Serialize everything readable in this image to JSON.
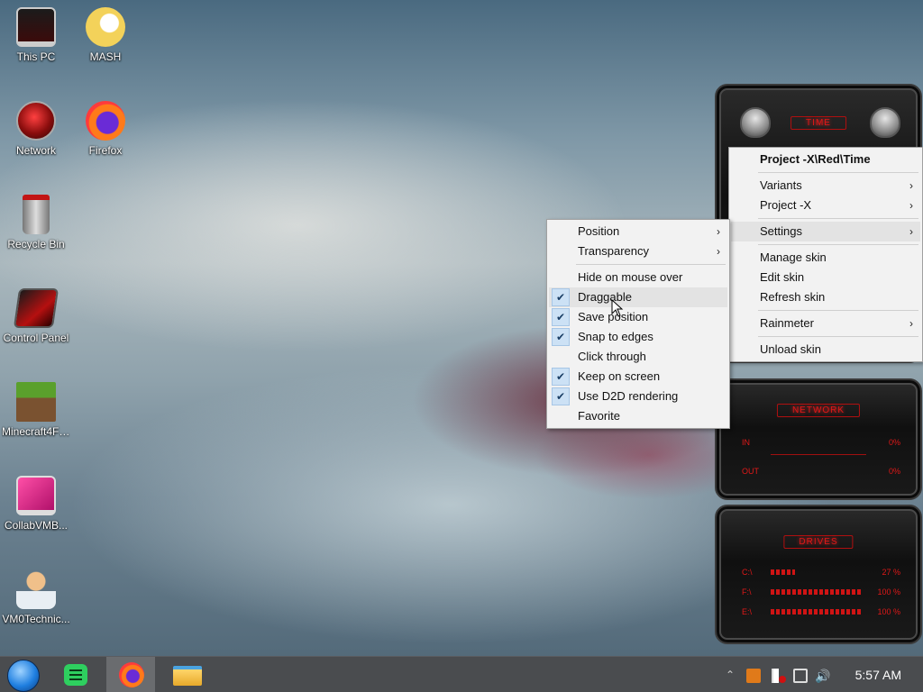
{
  "desktop": {
    "icons": [
      {
        "label": "This PC"
      },
      {
        "label": "MASH"
      },
      {
        "label": "Network"
      },
      {
        "label": "Firefox"
      },
      {
        "label": "Recycle Bin"
      },
      {
        "label": "Control Panel"
      },
      {
        "label": "Minecraft4Fr..."
      },
      {
        "label": "CollabVMB..."
      },
      {
        "label": "VM0Technic..."
      }
    ]
  },
  "skins": {
    "time": {
      "title": "TIME"
    },
    "network": {
      "title": "NETWORK",
      "in_label": "IN",
      "in_value": "0%",
      "out_label": "OUT",
      "out_value": "0%"
    },
    "drives": {
      "title": "DRIVES",
      "rows": [
        {
          "label": "C:\\",
          "value": "27 %",
          "fill": 0.27
        },
        {
          "label": "F:\\",
          "value": "100 %",
          "fill": 1.0
        },
        {
          "label": "E:\\",
          "value": "100 %",
          "fill": 1.0
        }
      ]
    }
  },
  "main_menu": {
    "header": "Project -X\\Red\\Time",
    "variants": "Variants",
    "project": "Project -X",
    "settings": "Settings",
    "manage": "Manage skin",
    "edit": "Edit skin",
    "refresh": "Refresh skin",
    "rainmeter": "Rainmeter",
    "unload": "Unload skin"
  },
  "settings_menu": {
    "position": "Position",
    "transparency": "Transparency",
    "hide": "Hide on mouse over",
    "draggable": "Draggable",
    "save_position": "Save position",
    "snap": "Snap to edges",
    "click_through": "Click through",
    "keep_on_screen": "Keep on screen",
    "d2d": "Use D2D rendering",
    "favorite": "Favorite"
  },
  "taskbar": {
    "clock": "5:57 AM"
  },
  "colors": {
    "skin_red": "#e01818",
    "menu_bg": "#f2f2f2",
    "taskbar_bg": "#4a4c4f"
  }
}
